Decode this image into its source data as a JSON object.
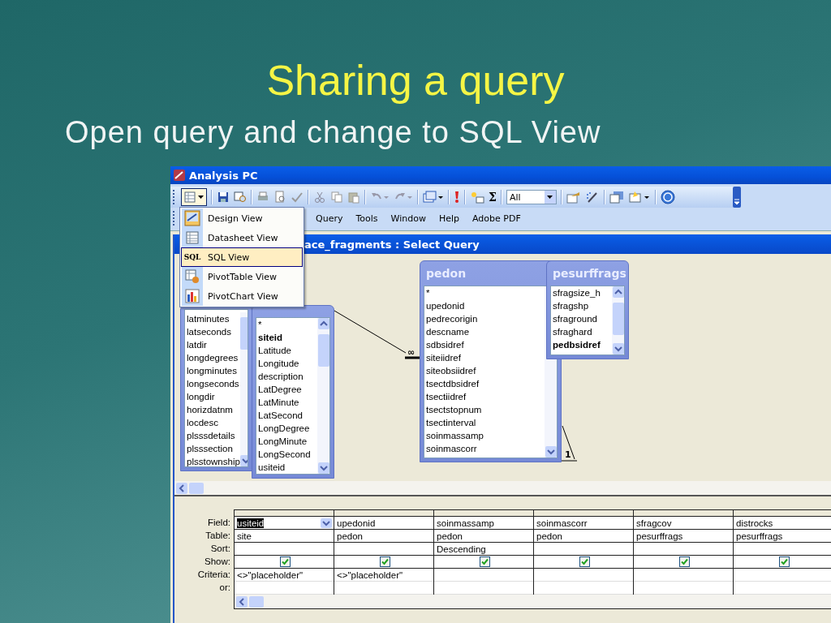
{
  "slide": {
    "title": "Sharing a query",
    "subtitle": "Open query and change to SQL View"
  },
  "window": {
    "title": "Analysis PC"
  },
  "toolbar": {
    "sigma": "Σ",
    "filter_combo": "All"
  },
  "menu_bar": [
    "Query",
    "Tools",
    "Window",
    "Help",
    "Adobe PDF"
  ],
  "view_menu": [
    {
      "label": "Design View",
      "selected": false
    },
    {
      "label": "Datasheet View",
      "selected": false
    },
    {
      "label": "SQL View",
      "icon_text": "SQL",
      "selected": true
    },
    {
      "label": "PivotTable View",
      "selected": false
    },
    {
      "label": "PivotChart View",
      "selected": false
    }
  ],
  "query_window": {
    "title": "ace_fragments : Select Query"
  },
  "tables": [
    {
      "fields": [
        {
          "name": "latminutes",
          "key": false
        },
        {
          "name": "latseconds",
          "key": false
        },
        {
          "name": "latdir",
          "key": false
        },
        {
          "name": "longdegrees",
          "key": false
        },
        {
          "name": "longminutes",
          "key": false
        },
        {
          "name": "longseconds",
          "key": false
        },
        {
          "name": "longdir",
          "key": false
        },
        {
          "name": "horizdatnm",
          "key": false
        },
        {
          "name": "locdesc",
          "key": false
        },
        {
          "name": "plsssdetails",
          "key": false
        },
        {
          "name": "plsssection",
          "key": false
        },
        {
          "name": "plsstownship",
          "key": false
        }
      ]
    },
    {
      "fields": [
        {
          "name": "*",
          "key": false
        },
        {
          "name": "siteid",
          "key": true
        },
        {
          "name": "Latitude",
          "key": false
        },
        {
          "name": "Longitude",
          "key": false
        },
        {
          "name": "description",
          "key": false
        },
        {
          "name": "LatDegree",
          "key": false
        },
        {
          "name": "LatMinute",
          "key": false
        },
        {
          "name": "LatSecond",
          "key": false
        },
        {
          "name": "LongDegree",
          "key": false
        },
        {
          "name": "LongMinute",
          "key": false
        },
        {
          "name": "LongSecond",
          "key": false
        },
        {
          "name": "usiteid",
          "key": false
        }
      ]
    },
    {
      "title": "pedon",
      "fields": [
        {
          "name": "*",
          "key": false
        },
        {
          "name": "upedonid",
          "key": false
        },
        {
          "name": "pedrecorigin",
          "key": false
        },
        {
          "name": "descname",
          "key": false
        },
        {
          "name": "sdbsidref",
          "key": false
        },
        {
          "name": "siteiidref",
          "key": false
        },
        {
          "name": "siteobsiidref",
          "key": false
        },
        {
          "name": "tsectdbsidref",
          "key": false
        },
        {
          "name": "tsectiidref",
          "key": false
        },
        {
          "name": "tsectstopnum",
          "key": false
        },
        {
          "name": "tsectinterval",
          "key": false
        },
        {
          "name": "soinmassamp",
          "key": false
        },
        {
          "name": "soinmascorr",
          "key": false
        }
      ]
    },
    {
      "title": "pesurffrags",
      "fields": [
        {
          "name": "sfragsize_h",
          "key": false
        },
        {
          "name": "sfragshp",
          "key": false
        },
        {
          "name": "sfraground",
          "key": false
        },
        {
          "name": "sfraghard",
          "key": false
        },
        {
          "name": "pedbsidref",
          "key": true
        }
      ]
    }
  ],
  "joins": [
    {
      "label": "∞"
    },
    {
      "label": "1"
    }
  ],
  "grid": {
    "row_labels": [
      "Field:",
      "Table:",
      "Sort:",
      "Show:",
      "Criteria:",
      "or:"
    ],
    "columns": [
      {
        "field": "usiteid",
        "selected": true,
        "table": "site",
        "show": true,
        "criteria": "<>\"placeholder\""
      },
      {
        "field": "upedonid",
        "selected": false,
        "table": "pedon",
        "show": true,
        "criteria": "<>\"placeholder\""
      },
      {
        "field": "soinmassamp",
        "selected": false,
        "table": "pedon",
        "sort": "Descending",
        "show": true
      },
      {
        "field": "soinmascorr",
        "selected": false,
        "table": "pedon",
        "show": true
      },
      {
        "field": "sfragcov",
        "selected": false,
        "table": "pesurffrags",
        "show": true
      },
      {
        "field": "distrocks",
        "selected": false,
        "table": "pesurffrags",
        "show": true
      }
    ]
  }
}
